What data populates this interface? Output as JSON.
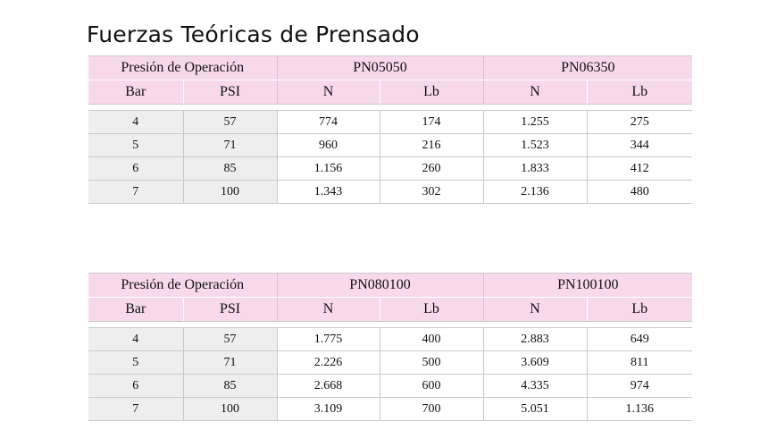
{
  "title": "Fuerzas Teóricas de Prensado",
  "pressure_header": "Presión de Operación",
  "units": {
    "bar": "Bar",
    "psi": "PSI",
    "n": "N",
    "lb": "Lb"
  },
  "tables": [
    {
      "models": [
        "PN05050",
        "PN06350"
      ],
      "rows": [
        {
          "bar": "4",
          "psi": "57",
          "m1_n": "774",
          "m1_lb": "174",
          "m2_n": "1.255",
          "m2_lb": "275"
        },
        {
          "bar": "5",
          "psi": "71",
          "m1_n": "960",
          "m1_lb": "216",
          "m2_n": "1.523",
          "m2_lb": "344"
        },
        {
          "bar": "6",
          "psi": "85",
          "m1_n": "1.156",
          "m1_lb": "260",
          "m2_n": "1.833",
          "m2_lb": "412"
        },
        {
          "bar": "7",
          "psi": "100",
          "m1_n": "1.343",
          "m1_lb": "302",
          "m2_n": "2.136",
          "m2_lb": "480"
        }
      ]
    },
    {
      "models": [
        "PN080100",
        "PN100100"
      ],
      "rows": [
        {
          "bar": "4",
          "psi": "57",
          "m1_n": "1.775",
          "m1_lb": "400",
          "m2_n": "2.883",
          "m2_lb": "649"
        },
        {
          "bar": "5",
          "psi": "71",
          "m1_n": "2.226",
          "m1_lb": "500",
          "m2_n": "3.609",
          "m2_lb": "811"
        },
        {
          "bar": "6",
          "psi": "85",
          "m1_n": "2.668",
          "m1_lb": "600",
          "m2_n": "4.335",
          "m2_lb": "974"
        },
        {
          "bar": "7",
          "psi": "100",
          "m1_n": "3.109",
          "m1_lb": "700",
          "m2_n": "5.051",
          "m2_lb": "1.136"
        }
      ]
    }
  ],
  "colors": {
    "header_pink": "#f8d9ec",
    "pressure_cell_gray": "#eeeeee",
    "rule_gray": "#c9c9c9"
  }
}
